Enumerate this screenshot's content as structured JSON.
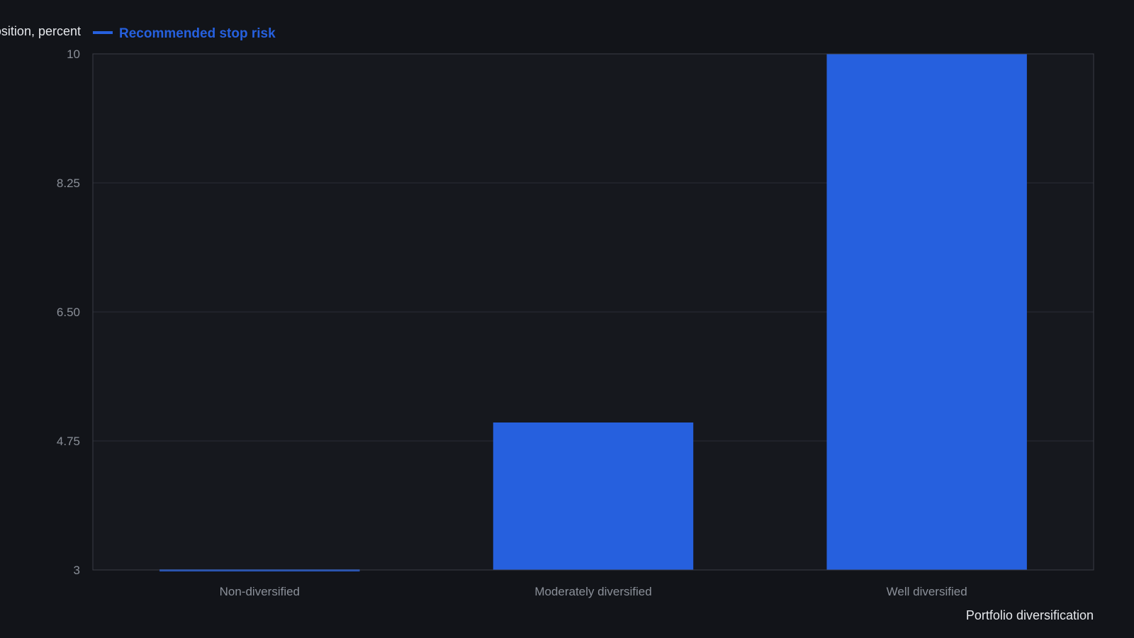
{
  "chart_data": {
    "type": "bar",
    "categories": [
      "Non-diversified",
      "Moderately diversified",
      "Well diversified"
    ],
    "series": [
      {
        "name": "Recommended stop risk",
        "values": [
          3,
          5,
          10
        ]
      }
    ],
    "xlabel": "Portfolio diversification",
    "ylabel": "Stop risk per position, percent",
    "ylim": [
      3,
      10
    ],
    "yticks": [
      "3",
      "4.75",
      "6.50",
      "8.25",
      "10"
    ],
    "grid": true,
    "legend_position": "top-left",
    "colors": {
      "background": "#121419",
      "plot_background": "#16181e",
      "grid": "#2a2d35",
      "axis": "#3a3d45",
      "bar": "#2660de",
      "tick_text": "#8a8f98",
      "title_text": "#e6e8ec"
    }
  }
}
